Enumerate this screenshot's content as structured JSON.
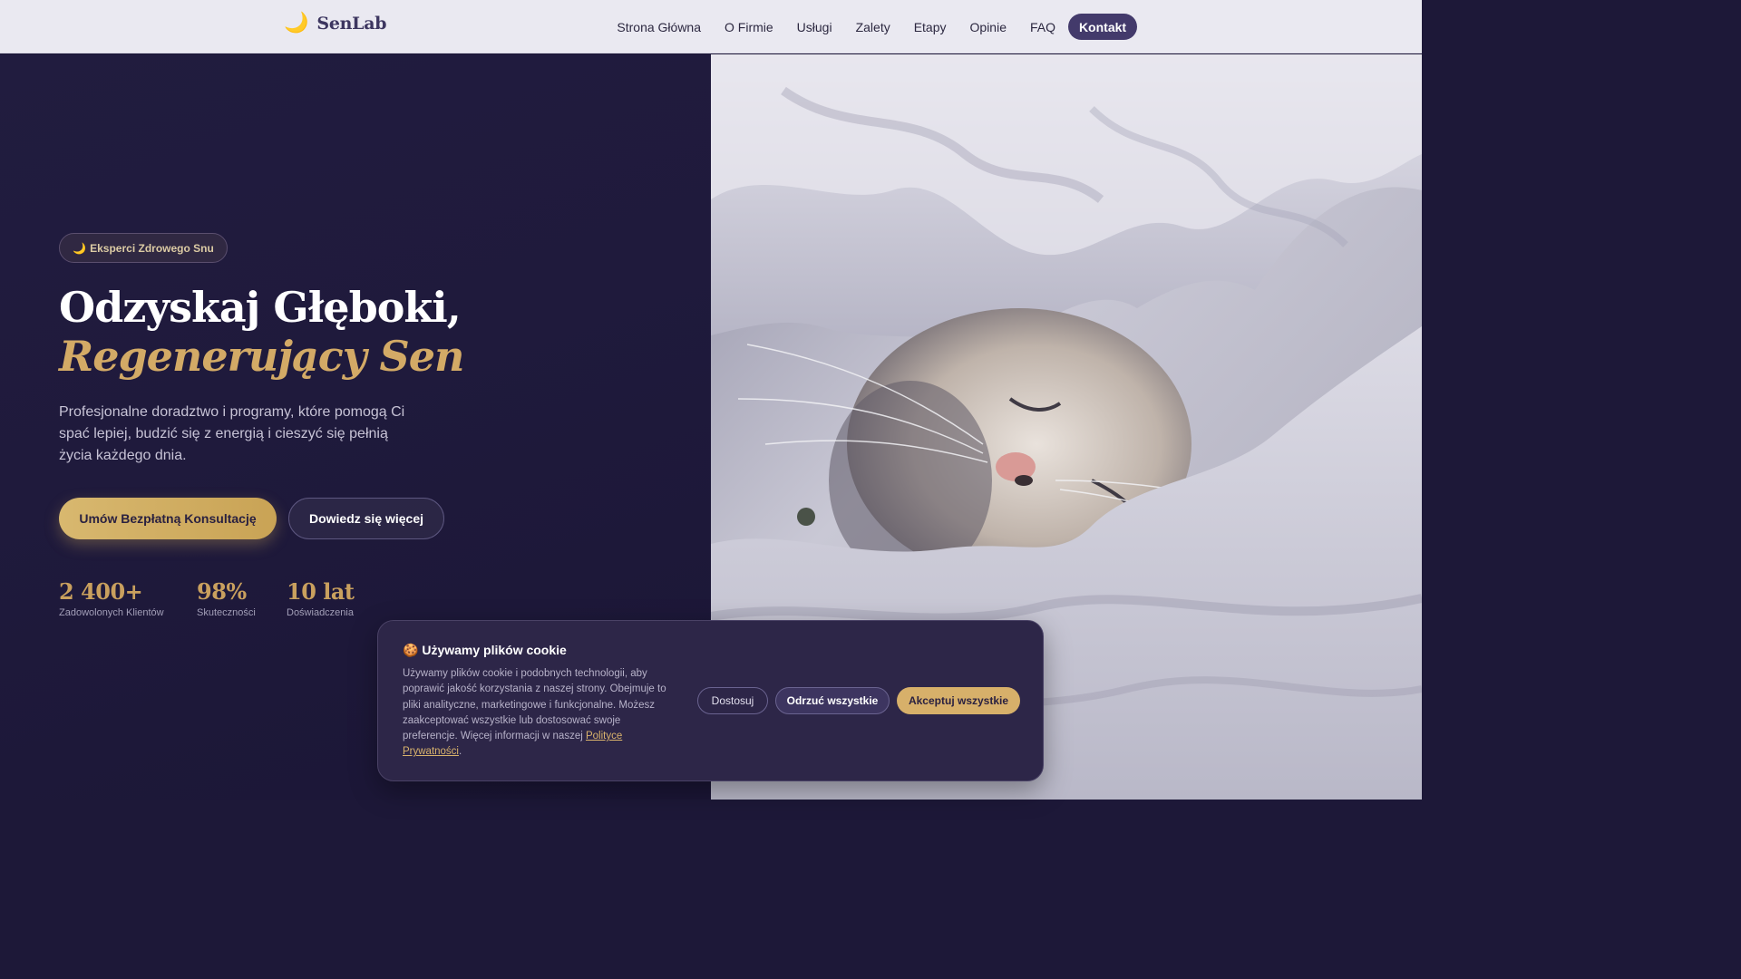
{
  "header": {
    "logo_text": "SenLab",
    "logo_icon": "moon-icon",
    "nav": [
      "Strona Główna",
      "O Firmie",
      "Usługi",
      "Zalety",
      "Etapy",
      "Opinie",
      "FAQ"
    ],
    "cta_label": "Kontakt"
  },
  "hero": {
    "badge": "Eksperci Zdrowego Snu",
    "badge_icon": "moon-icon",
    "title_line1": "Odzyskaj Głęboki,",
    "title_line2": "Regenerujący Sen",
    "lead": "Profesjonalne doradztwo i programy, które pomogą Ci spać lepiej, budzić się z energią i cieszyć się pełnią życia każdego dnia.",
    "primary_button": "Umów Bezpłatną Konsultację",
    "secondary_button": "Dowiedz się więcej",
    "stats": [
      {
        "value": "2 400+",
        "label": "Zadowolonych Klientów"
      },
      {
        "value": "98%",
        "label": "Skuteczności"
      },
      {
        "value": "10 lat",
        "label": "Doświadczenia"
      }
    ]
  },
  "cookie": {
    "icon": "cookie-icon",
    "title": "Używamy plików cookie",
    "text": "Używamy plików cookie i podobnych technologii, aby poprawić jakość korzystania z naszej strony. Obejmuje to pliki analityczne, marketingowe i funkcjonalne. Możesz zaakceptować wszystkie lub dostosować swoje preferencje. Więcej informacji w naszej",
    "link_text": "Polityce Prywatności",
    "text_end": ".",
    "buttons": {
      "customize": "Dostosuj",
      "reject": "Odrzuć wszystkie",
      "accept": "Akceptuj wszystkie"
    }
  },
  "colors": {
    "accent_gold": "#d3aa66",
    "nav_cta": "#433a6b",
    "hero_bg": "#1f1a3c"
  }
}
